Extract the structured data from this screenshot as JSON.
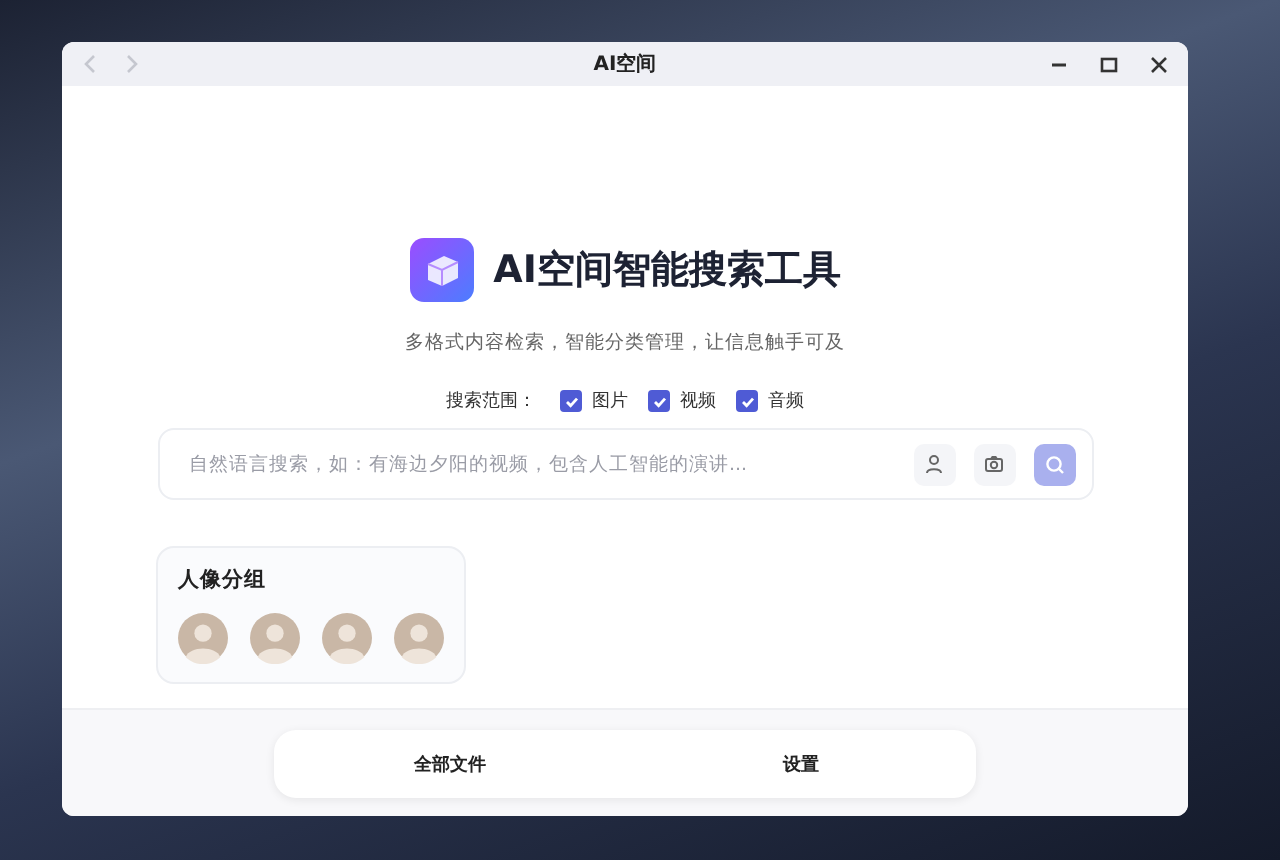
{
  "window": {
    "title": "AI空间"
  },
  "app": {
    "title": "AI空间智能搜索工具",
    "subtitle": "多格式内容检索，智能分类管理，让信息触手可及"
  },
  "scope": {
    "label": "搜索范围：",
    "options": [
      {
        "label": "图片",
        "checked": true
      },
      {
        "label": "视频",
        "checked": true
      },
      {
        "label": "音频",
        "checked": true
      }
    ]
  },
  "search": {
    "placeholder": "自然语言搜索，如：有海边夕阳的视频，包含人工智能的演讲..."
  },
  "portrait_group": {
    "title": "人像分组",
    "avatars": [
      {
        "kind": "photo"
      },
      {
        "kind": "photo"
      },
      {
        "kind": "photo"
      },
      {
        "kind": "photo"
      }
    ]
  },
  "nav": [
    {
      "label": "全部文件"
    },
    {
      "label": "设置"
    }
  ]
}
